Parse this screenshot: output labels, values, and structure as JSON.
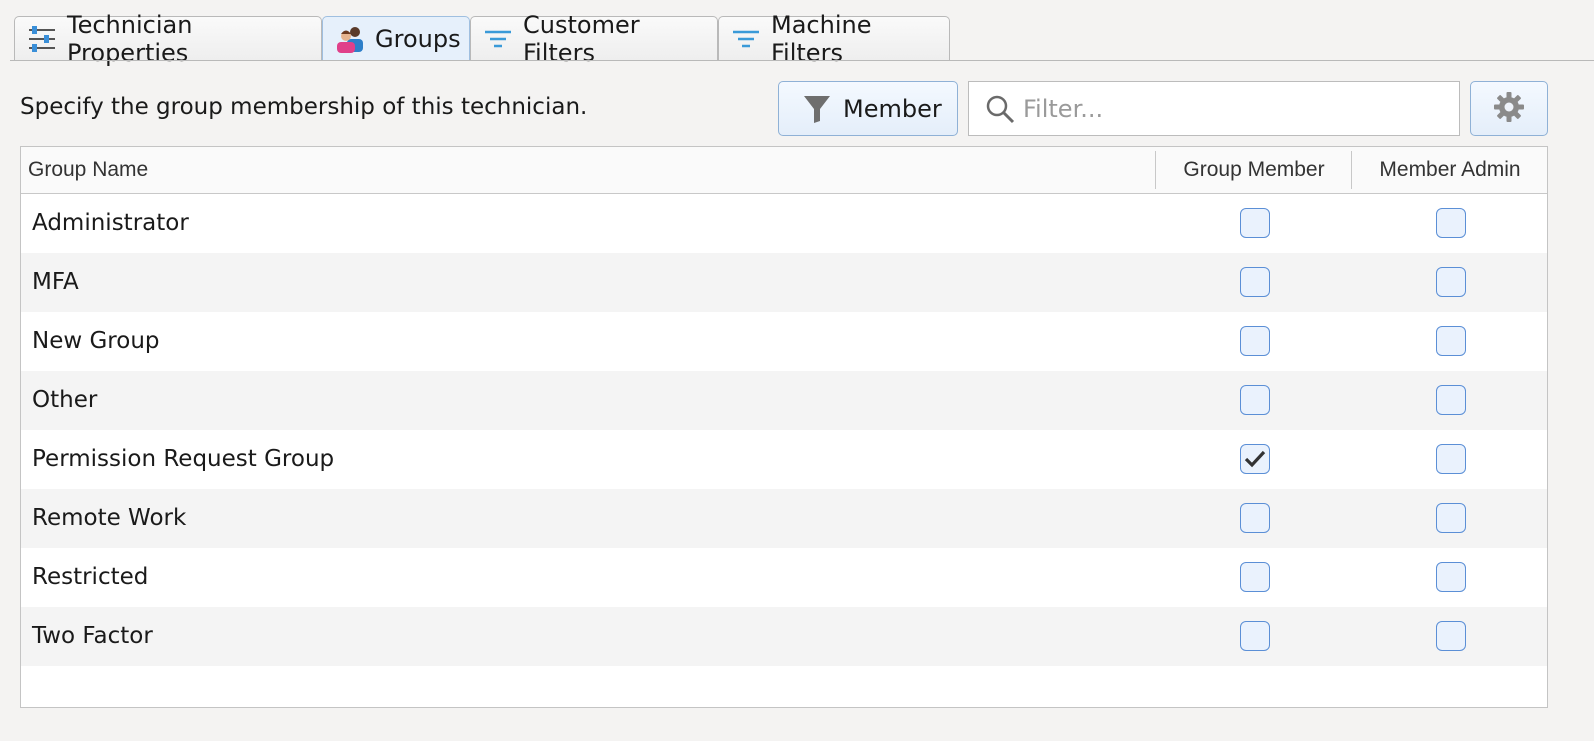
{
  "tabs": [
    {
      "label": "Technician Properties",
      "icon": "sliders-icon",
      "active": false
    },
    {
      "label": "Groups",
      "icon": "users-icon",
      "active": true
    },
    {
      "label": "Customer Filters",
      "icon": "filter-lines-icon",
      "active": false
    },
    {
      "label": "Machine Filters",
      "icon": "filter-lines-icon",
      "active": false
    }
  ],
  "description": "Specify the group membership of this technician.",
  "toolbar": {
    "member_label": "Member",
    "filter_placeholder": "Filter...",
    "filter_value": ""
  },
  "table": {
    "columns": {
      "name": "Group Name",
      "member": "Group Member",
      "admin": "Member Admin"
    },
    "rows": [
      {
        "name": "Administrator",
        "member": false,
        "admin": false
      },
      {
        "name": "MFA",
        "member": false,
        "admin": false
      },
      {
        "name": "New Group",
        "member": false,
        "admin": false
      },
      {
        "name": "Other",
        "member": false,
        "admin": false
      },
      {
        "name": "Permission Request Group",
        "member": true,
        "admin": false
      },
      {
        "name": "Remote Work",
        "member": false,
        "admin": false
      },
      {
        "name": "Restricted",
        "member": false,
        "admin": false
      },
      {
        "name": "Two Factor",
        "member": false,
        "admin": false
      }
    ]
  },
  "colors": {
    "accent": "#5b8fd6",
    "checkbox_fill": "#eaf2fd",
    "active_tab": "#e6f0fb"
  }
}
